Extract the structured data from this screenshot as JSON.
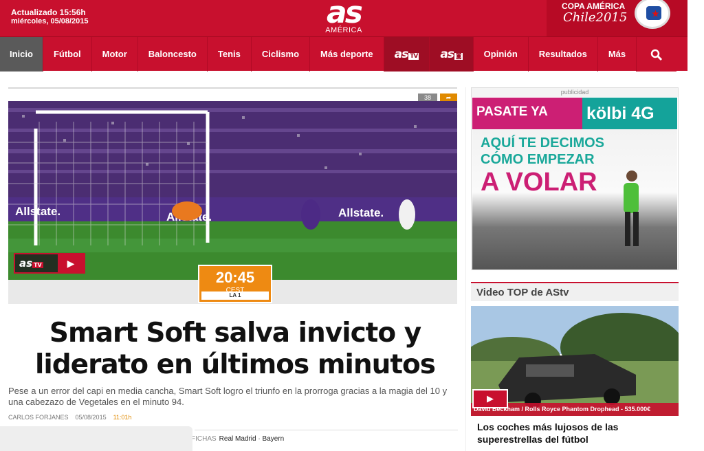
{
  "header": {
    "updated": "Actualizado 15:56h",
    "date": "miércoles, 05/08/2015",
    "logo": "as",
    "edition": "AMÉRICA",
    "promo_line1": "COPA AMÉRICA",
    "promo_line2": "Chile2015"
  },
  "nav": {
    "items": [
      "Inicio",
      "Fútbol",
      "Motor",
      "Baloncesto",
      "Tenis",
      "Ciclismo",
      "Más deporte",
      "as",
      "as",
      "Opinión",
      "Resultados",
      "Más"
    ],
    "tv_badge": "TV",
    "active": "Inicio",
    "search_icon": "search-icon"
  },
  "main": {
    "counter": "38",
    "video_badge": "as",
    "video_badge_sub": "TV",
    "play": "▶",
    "time": "20:45",
    "tz": "CEST",
    "league": "LA 1",
    "headline": "Smart Soft salva invicto y liderato en últimos minutos",
    "lede": "Pese a un error del capi en media cancha, Smart Soft logro el triunfo en la prorroga gracias a la magia del 10 y una cabezazo de Vegetales en el minuto 94.",
    "author": "CARLOS FORJANES",
    "pub_date": "05/08/2015",
    "pub_time": "11:01h",
    "tags_label": "FICHAS",
    "tags": "Real Madrid · Bayern"
  },
  "sidebar": {
    "ad_label": "publicidad",
    "ad_line1": "PASATE YA",
    "ad_line2": "kölbi 4G",
    "ad_line3": "AQUÍ TE DECIMOS",
    "ad_line4": "CÓMO EMPEZAR",
    "ad_line5": "A VOLAR",
    "video_section": "Video TOP de AStv",
    "video_caption": "David Beckham / Rolls Royce Phantom Drophead - 535.000€",
    "video_title": "Los coches más lujosos de las superestrellas del fútbol"
  },
  "colors": {
    "brand": "#c8102e",
    "accent": "#ee8a12",
    "nav_active": "#5a5a5a"
  }
}
